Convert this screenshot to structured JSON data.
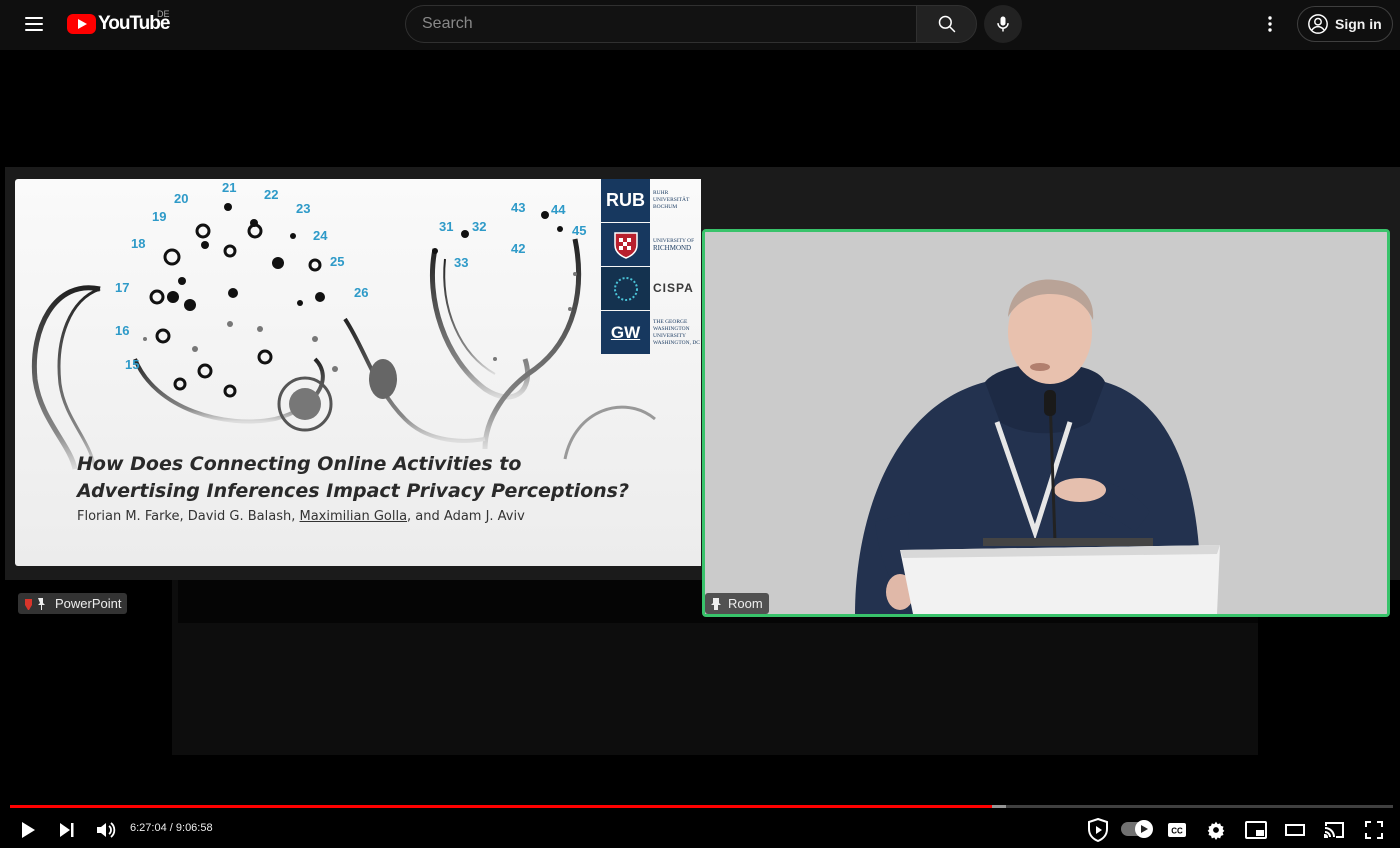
{
  "header": {
    "logo_text": "YouTube",
    "country_code": "DE",
    "search_placeholder": "Search",
    "signin_label": "Sign in"
  },
  "slide": {
    "title_line1": "How Does Connecting Online Activities to",
    "title_line2": "Advertising Inferences Impact Privacy Perceptions?",
    "authors_pre": "Florian M. Farke, David G. Balash, ",
    "authors_underlined": "Maximilian Golla",
    "authors_post": ", and Adam J. Aviv",
    "numbers": [
      "15",
      "16",
      "17",
      "18",
      "19",
      "20",
      "21",
      "22",
      "23",
      "24",
      "25",
      "26",
      "31",
      "32",
      "33",
      "42",
      "43",
      "44",
      "45"
    ],
    "number_color": "#2e9ac8",
    "logos": [
      {
        "mark": "RUB",
        "name": [
          "RUHR",
          "UNIVERSITÄT",
          "BOCHUM"
        ]
      },
      {
        "mark": "",
        "name": [
          "UNIVERSITY OF",
          "RICHMOND"
        ]
      },
      {
        "mark": "",
        "name": [
          "CISPA"
        ]
      },
      {
        "mark": "GW",
        "name": [
          "THE GEORGE",
          "WASHINGTON",
          "UNIVERSITY",
          "WASHINGTON, DC"
        ]
      }
    ],
    "source_tag": "PowerPoint"
  },
  "camera": {
    "source_tag": "Room",
    "border_color": "#39c36b"
  },
  "player": {
    "current_time": "6:27:04",
    "time_separator": "/",
    "duration": "9:06:58",
    "progress_fraction": 0.71,
    "buffered_fraction": 0.72,
    "progress_color": "#ff0000"
  }
}
